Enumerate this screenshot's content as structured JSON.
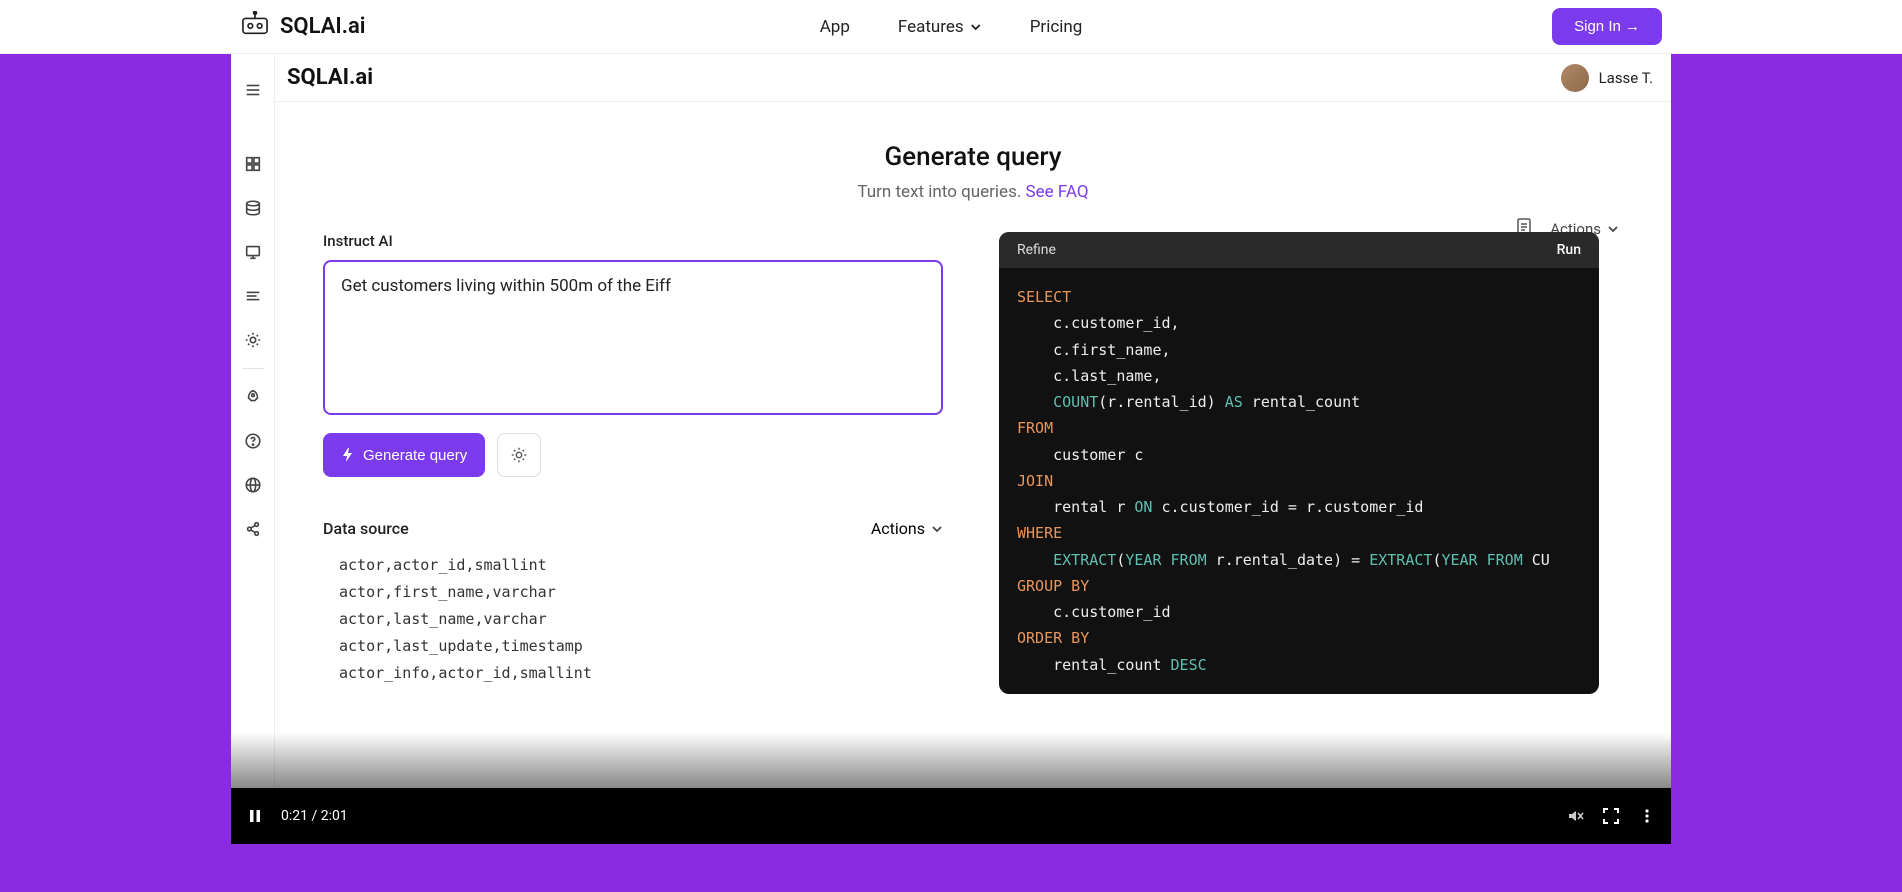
{
  "outerNav": {
    "brand": "SQLAI.ai",
    "items": [
      "App",
      "Features",
      "Pricing"
    ],
    "signIn": "Sign In →"
  },
  "app": {
    "title": "SQLAI.ai",
    "userName": "Lasse T."
  },
  "hero": {
    "title": "Generate query",
    "subtitle": "Turn text into queries. ",
    "link": "See FAQ"
  },
  "instruct": {
    "label": "Instruct AI",
    "actionsLabel": "Actions",
    "promptValue": "Get customers living within 500m of the Eiff",
    "generateLabel": "Generate query"
  },
  "dataSource": {
    "label": "Data source",
    "actionsLabel": "Actions",
    "rows": [
      "actor,actor_id,smallint",
      "actor,first_name,varchar",
      "actor,last_name,varchar",
      "actor,last_update,timestamp",
      "actor_info,actor_id,smallint"
    ]
  },
  "sqlPanel": {
    "refine": "Refine",
    "run": "Run",
    "lines": [
      {
        "t": "SELECT",
        "c": "orange"
      },
      {
        "t": "    c.customer_id,",
        "c": "plain"
      },
      {
        "t": "    c.first_name,",
        "c": "plain"
      },
      {
        "t": "    c.last_name,",
        "c": "plain"
      },
      {
        "segs": [
          {
            "t": "    ",
            "c": "plain"
          },
          {
            "t": "COUNT",
            "c": "teal"
          },
          {
            "t": "(r.rental_id) ",
            "c": "plain"
          },
          {
            "t": "AS",
            "c": "teal"
          },
          {
            "t": " rental_count",
            "c": "plain"
          }
        ]
      },
      {
        "t": "FROM",
        "c": "orange"
      },
      {
        "t": "    customer c",
        "c": "plain"
      },
      {
        "t": "JOIN",
        "c": "orange"
      },
      {
        "segs": [
          {
            "t": "    rental r ",
            "c": "plain"
          },
          {
            "t": "ON",
            "c": "teal"
          },
          {
            "t": " c.customer_id = r.customer_id",
            "c": "plain"
          }
        ]
      },
      {
        "t": "WHERE",
        "c": "orange"
      },
      {
        "segs": [
          {
            "t": "    ",
            "c": "plain"
          },
          {
            "t": "EXTRACT",
            "c": "teal"
          },
          {
            "t": "(",
            "c": "plain"
          },
          {
            "t": "YEAR FROM",
            "c": "teal"
          },
          {
            "t": " r.rental_date) = ",
            "c": "plain"
          },
          {
            "t": "EXTRACT",
            "c": "teal"
          },
          {
            "t": "(",
            "c": "plain"
          },
          {
            "t": "YEAR FROM",
            "c": "teal"
          },
          {
            "t": " CU",
            "c": "plain"
          }
        ]
      },
      {
        "t": "GROUP BY",
        "c": "orange"
      },
      {
        "t": "    c.customer_id",
        "c": "plain"
      },
      {
        "t": "ORDER BY",
        "c": "orange"
      },
      {
        "segs": [
          {
            "t": "    rental_count ",
            "c": "plain"
          },
          {
            "t": "DESC",
            "c": "teal"
          }
        ]
      }
    ]
  },
  "video": {
    "current": "0:21",
    "sep": " / ",
    "total": "2:01"
  }
}
